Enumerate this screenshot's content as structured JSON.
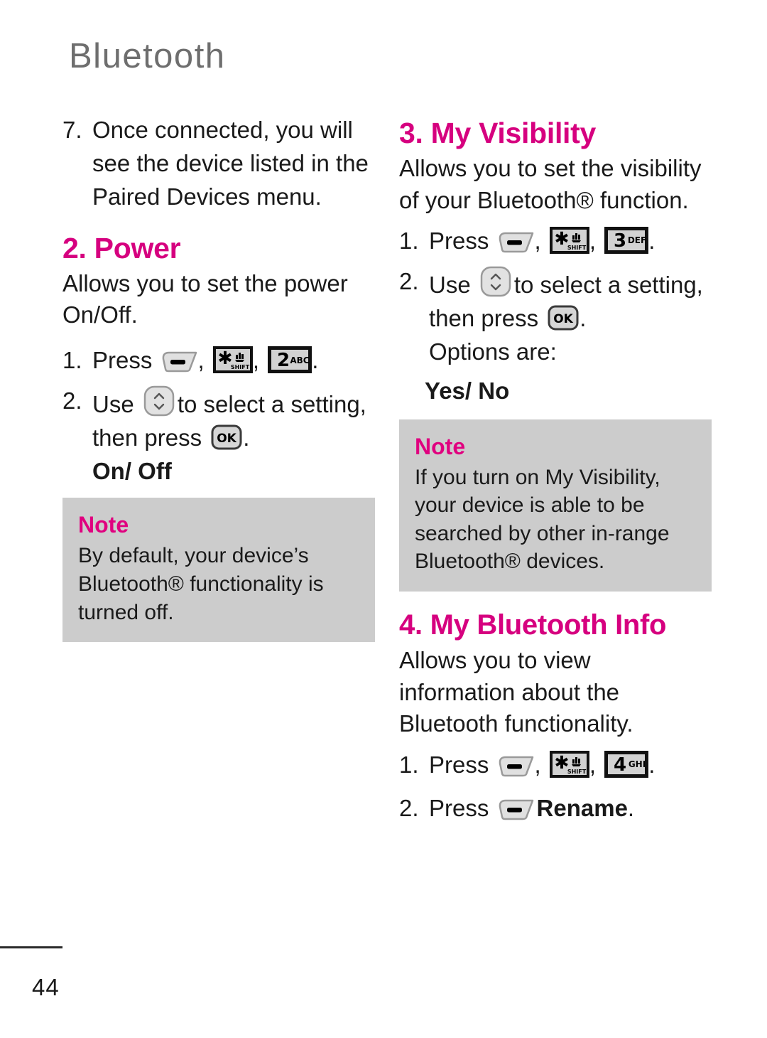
{
  "header": {
    "title": "Bluetooth"
  },
  "left_column": {
    "step7": {
      "number": "7.",
      "text": "Once connected, you will see the device listed in the Paired Devices menu."
    },
    "power": {
      "heading": "2. Power",
      "description": "Allows you to set the power On/Off.",
      "step1_number": "1.",
      "step1_press_label": "Press",
      "step1_keys": [
        "softkey-left",
        "star-shift",
        "2-ABC"
      ],
      "step1_tail": ".",
      "step2_number": "2.",
      "step2_use_label": "Use",
      "step2_nav_key": "nav-up-down",
      "step2_text": "to select a setting,",
      "step2_then_press": "then press",
      "step2_ok_key": "OK",
      "step2_tail": ".",
      "options": "On/ Off"
    },
    "note": {
      "title": "Note",
      "text": "By default, your device’s Bluetooth® functionality is turned off."
    }
  },
  "right_column": {
    "visibility": {
      "heading": "3. My Visibility",
      "description": "Allows you to set the visibility of your Bluetooth® function.",
      "step1_number": "1.",
      "step1_press_label": "Press",
      "step1_keys": [
        "softkey-left",
        "star-shift",
        "3-DEF"
      ],
      "step1_tail": ".",
      "step2_number": "2.",
      "step2_use_label": "Use",
      "step2_nav_key": "nav-up-down",
      "step2_text": "to select a setting,",
      "step2_then_press": "then press",
      "step2_ok_key": "OK",
      "step2_tail": ".",
      "options_label": "Options are:",
      "options": "Yes/ No"
    },
    "note": {
      "title": "Note",
      "text": "If you turn on My Visibility, your device is able to be searched by other in-range Bluetooth® devices."
    },
    "bt_info": {
      "heading": "4. My Bluetooth Info",
      "description": "Allows you to view information about the Bluetooth functionality.",
      "step1_number": "1.",
      "step1_press_label": "Press",
      "step1_keys": [
        "softkey-left",
        "star-shift",
        "4-GHI"
      ],
      "step1_tail": ".",
      "step2_number": "2.",
      "step2_press_label": "Press",
      "step2_key": "softkey-left",
      "step2_bold_text": "Rename",
      "step2_tail": "."
    }
  },
  "keypad_labels": {
    "star": "✱",
    "shift": "SHIFT",
    "two": "2",
    "two_letters": "ABC",
    "three": "3",
    "three_letters": "DEF",
    "four": "4",
    "four_letters": "GHI",
    "ok": "OK"
  },
  "footer": {
    "page_number": "44"
  },
  "colors": {
    "accent_pink": "#d6007f",
    "note_pink": "#e0007f",
    "header_gray": "#6e6e6e",
    "note_bg": "#cccccc",
    "body_text": "#1a1a1a"
  }
}
